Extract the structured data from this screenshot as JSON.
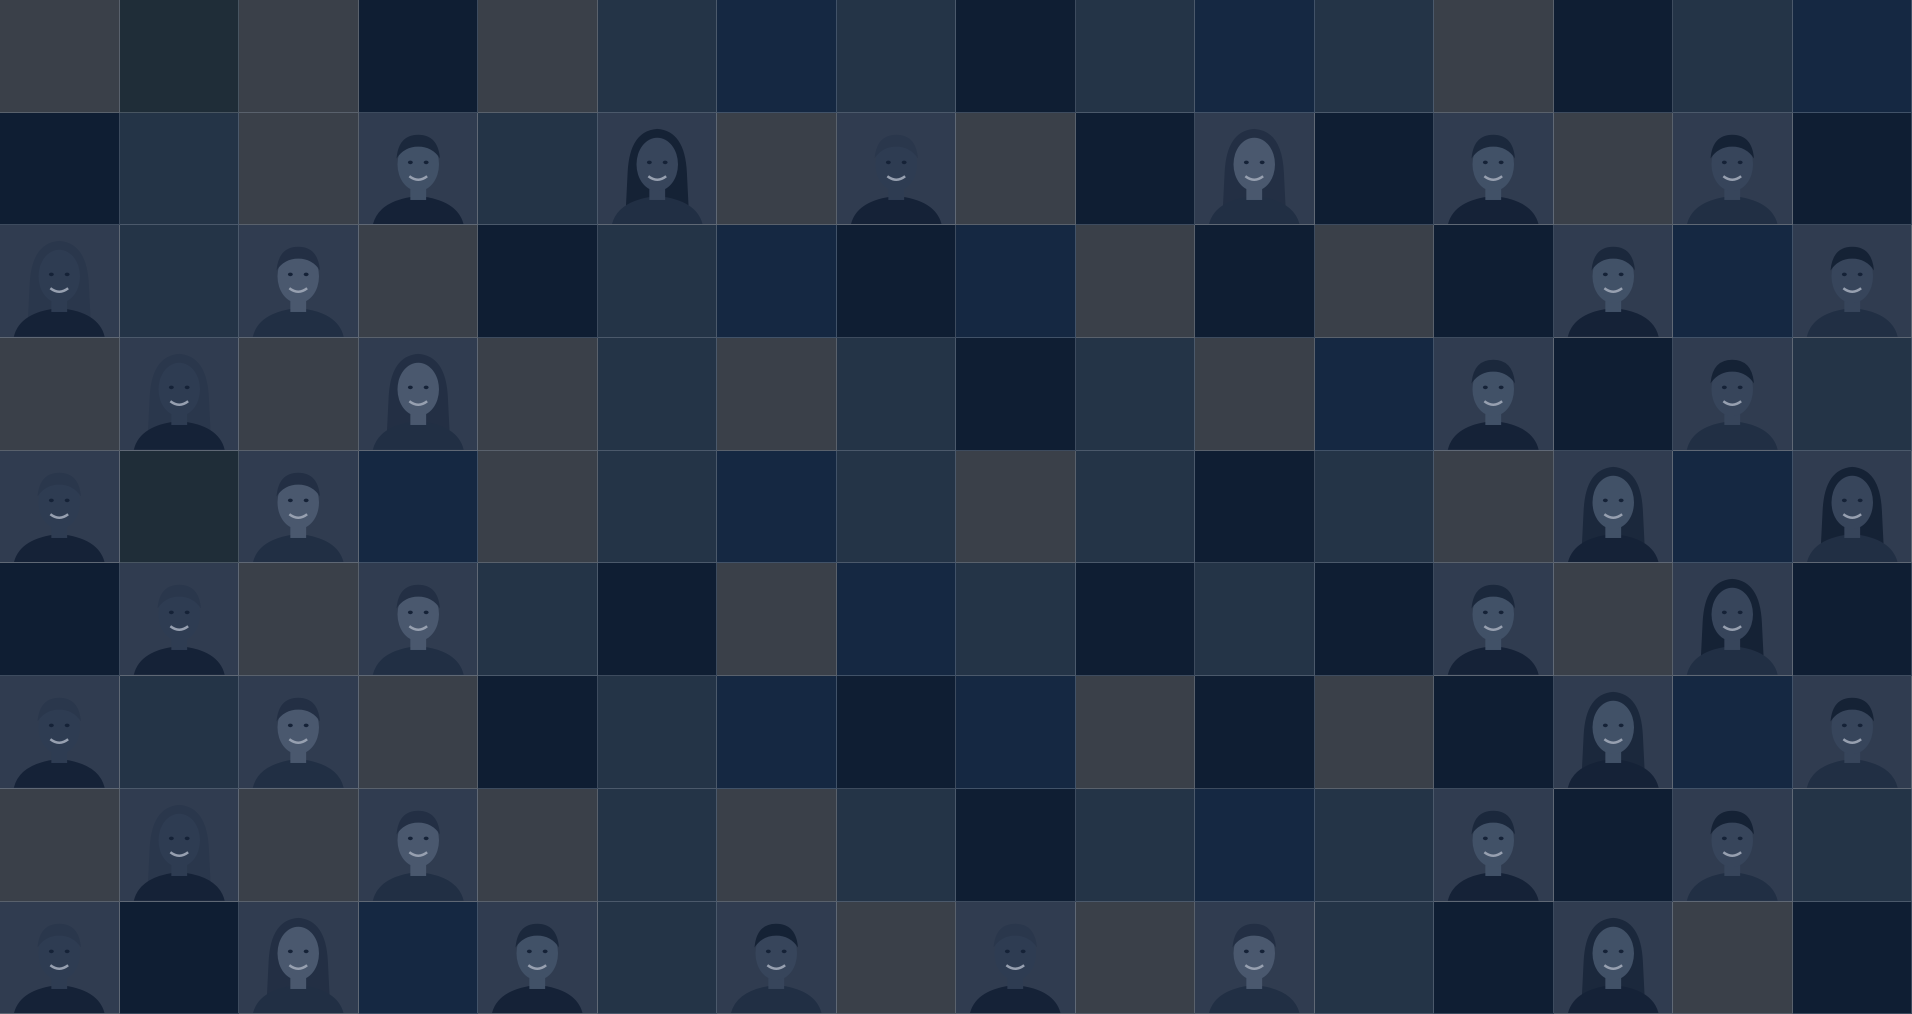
{
  "palette": {
    "grey": "#3a4049",
    "slate": "#243447",
    "navy": "#152842",
    "deep": "#0f1e33",
    "ink": "#1b2b3f",
    "teal": "#1f2d38"
  },
  "grid": {
    "columns": 16,
    "rows": 9,
    "tiles": [
      [
        "grey",
        "teal",
        "grey",
        "deep",
        "grey",
        "slate",
        "navy",
        "slate",
        "deep",
        "slate",
        "navy",
        "slate",
        "grey",
        "deep",
        "slate",
        "navy"
      ],
      [
        "deep",
        "slate",
        "grey",
        "face",
        "slate",
        "face",
        "grey",
        "face",
        "grey",
        "deep",
        "face",
        "deep",
        "face",
        "grey",
        "face",
        "deep"
      ],
      [
        "face",
        "slate",
        "face",
        "grey",
        "deep",
        "slate",
        "navy",
        "deep",
        "navy",
        "grey",
        "deep",
        "grey",
        "deep",
        "face",
        "navy",
        "face"
      ],
      [
        "grey",
        "face",
        "grey",
        "face",
        "grey",
        "slate",
        "grey",
        "slate",
        "deep",
        "slate",
        "grey",
        "navy",
        "face",
        "deep",
        "face",
        "slate"
      ],
      [
        "face",
        "teal",
        "face",
        "navy",
        "grey",
        "slate",
        "navy",
        "slate",
        "grey",
        "slate",
        "deep",
        "slate",
        "grey",
        "face",
        "navy",
        "face"
      ],
      [
        "deep",
        "face",
        "grey",
        "face",
        "slate",
        "deep",
        "grey",
        "navy",
        "slate",
        "deep",
        "slate",
        "deep",
        "face",
        "grey",
        "face",
        "deep"
      ],
      [
        "face",
        "slate",
        "face",
        "grey",
        "deep",
        "slate",
        "navy",
        "deep",
        "navy",
        "grey",
        "deep",
        "grey",
        "deep",
        "face",
        "navy",
        "face"
      ],
      [
        "grey",
        "face",
        "grey",
        "face",
        "grey",
        "slate",
        "grey",
        "slate",
        "deep",
        "slate",
        "navy",
        "slate",
        "face",
        "deep",
        "face",
        "slate"
      ],
      [
        "face",
        "deep",
        "face",
        "navy",
        "face",
        "slate",
        "face",
        "grey",
        "face",
        "grey",
        "face",
        "slate",
        "deep",
        "face",
        "grey",
        "deep"
      ]
    ]
  },
  "faces": {
    "skin_tones": [
      "#5d6a7a",
      "#4d5868",
      "#3f4a5a",
      "#6a7585"
    ],
    "hair_tones": [
      "#1a222d",
      "#232c38",
      "#2e3744",
      "#3a4250"
    ]
  }
}
